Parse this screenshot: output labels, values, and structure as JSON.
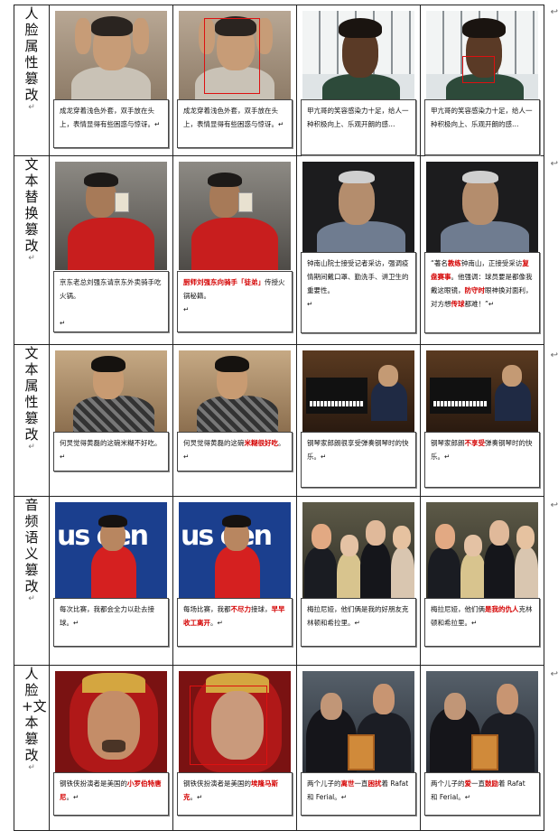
{
  "rows": [
    {
      "label": "人脸属性篡改",
      "captions": [
        [
          "成龙穿着浅色外套，双手放在头上，表情显得有些困惑与惊讶。"
        ],
        [
          "成龙穿着浅色外套，双手放在头上，表情显得有些困惑与惊讶。"
        ],
        [
          "甲亢哥的笑容感染力十足，给人一种积极向上、乐观开朗的感…"
        ],
        [
          "甲亢哥的笑容感染力十足，给人一种积极向上、乐观开朗的感…"
        ]
      ]
    },
    {
      "label": "文本替换篡改",
      "captions": [
        [
          "京东老总刘强东请京东外卖骑手吃火锅。"
        ],
        [
          "厨师刘强东向骑手",
          "「徒弟」",
          "传授火锅秘籍。"
        ],
        [
          "钟南山院士接受记者采访，强调疫情期间戴口罩、勤洗手、讲卫生的重要性。"
        ],
        [
          "“著名",
          "教练",
          "钟南山，正接受采访",
          "复盘赛事",
          "。他强调：球员要是都像我戴这眼镜，",
          "防守时",
          "眼神换对面利，对方想",
          "传球",
          "都难！”"
        ]
      ]
    },
    {
      "label": "文本属性篡改",
      "captions": [
        [
          "何炅觉得黄磊的这碗米糊不好吃。"
        ],
        [
          "何炅觉得黄磊的这碗",
          "米糊很好吃",
          "。"
        ],
        [
          "钢琴家郎朗很享受弹奏钢琴时的快乐。"
        ],
        [
          "钢琴家郎朗",
          "不享受",
          "弹奏钢琴时的快乐。"
        ]
      ]
    },
    {
      "label": "音频语义篡改",
      "captions": [
        [
          "每次比赛，我都会全力以赴去接球。"
        ],
        [
          "每场比赛，我都",
          "不尽力",
          "接球，",
          "早早收工离开",
          "。"
        ],
        [
          "梅拉尼娅，他们俩是我的好朋友克林顿和希拉里。"
        ],
        [
          "梅拉尼娅，他们俩",
          "是我的仇人",
          "克林顿和希拉里。"
        ]
      ]
    },
    {
      "label": "人脸+文本篡改",
      "captions": [
        [
          "钢铁侠扮演者是美国的",
          "小罗伯特唐尼",
          "。"
        ],
        [
          "钢铁侠扮演者是美国的",
          "埃隆马斯克",
          "。"
        ],
        [
          "两个儿子的",
          "离世",
          "一直",
          "困扰",
          "着 Rafat 和 Ferial。"
        ],
        [
          "两个儿子的",
          "爱",
          "一直",
          "鼓励",
          "着 Rafat 和 Ferial。"
        ]
      ]
    }
  ],
  "return_mark": "↵",
  "edge_marker": "↩"
}
